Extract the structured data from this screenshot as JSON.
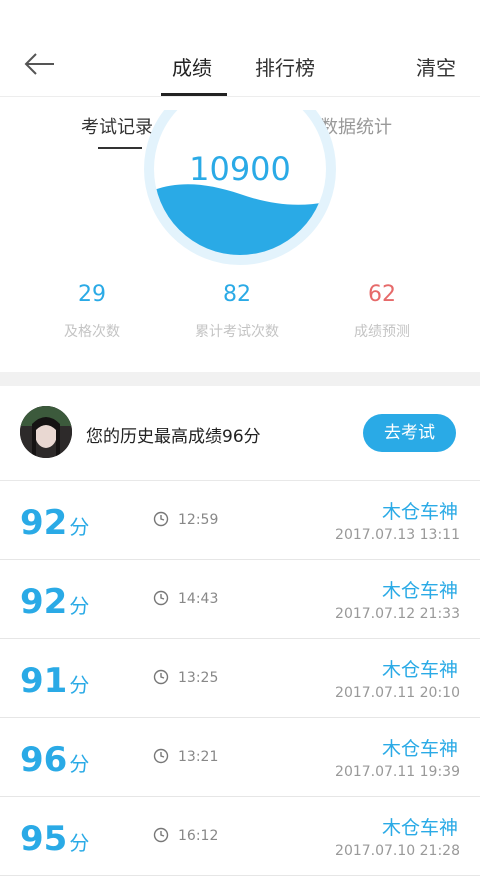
{
  "header": {
    "tabs": [
      {
        "label": "成绩",
        "active": true
      },
      {
        "label": "排行榜",
        "active": false
      }
    ],
    "clear_label": "清空"
  },
  "subtabs": [
    {
      "label": "考试记录",
      "active": true
    },
    {
      "label": "数据统计",
      "active": false
    }
  ],
  "gauge": {
    "score": "10900"
  },
  "stats": [
    {
      "value": "29",
      "label": "及格次数"
    },
    {
      "value": "82",
      "label": "累计考试次数"
    },
    {
      "value": "62",
      "label": "成绩预测"
    }
  ],
  "profile": {
    "best_text": "您的历史最高成绩96分",
    "go_label": "去考试"
  },
  "records": [
    {
      "score": "92",
      "unit": "分",
      "duration": "12:59",
      "name": "木仓车神",
      "date": "2017.07.13  13:11"
    },
    {
      "score": "92",
      "unit": "分",
      "duration": "14:43",
      "name": "木仓车神",
      "date": "2017.07.12  21:33"
    },
    {
      "score": "91",
      "unit": "分",
      "duration": "13:25",
      "name": "木仓车神",
      "date": "2017.07.11  20:10"
    },
    {
      "score": "96",
      "unit": "分",
      "duration": "13:21",
      "name": "木仓车神",
      "date": "2017.07.11  19:39"
    },
    {
      "score": "95",
      "unit": "分",
      "duration": "16:12",
      "name": "木仓车神",
      "date": "2017.07.10  21:28"
    }
  ],
  "colors": {
    "accent": "#2aaae6",
    "prediction": "#e66a6a",
    "muted": "#c4c4c4"
  }
}
